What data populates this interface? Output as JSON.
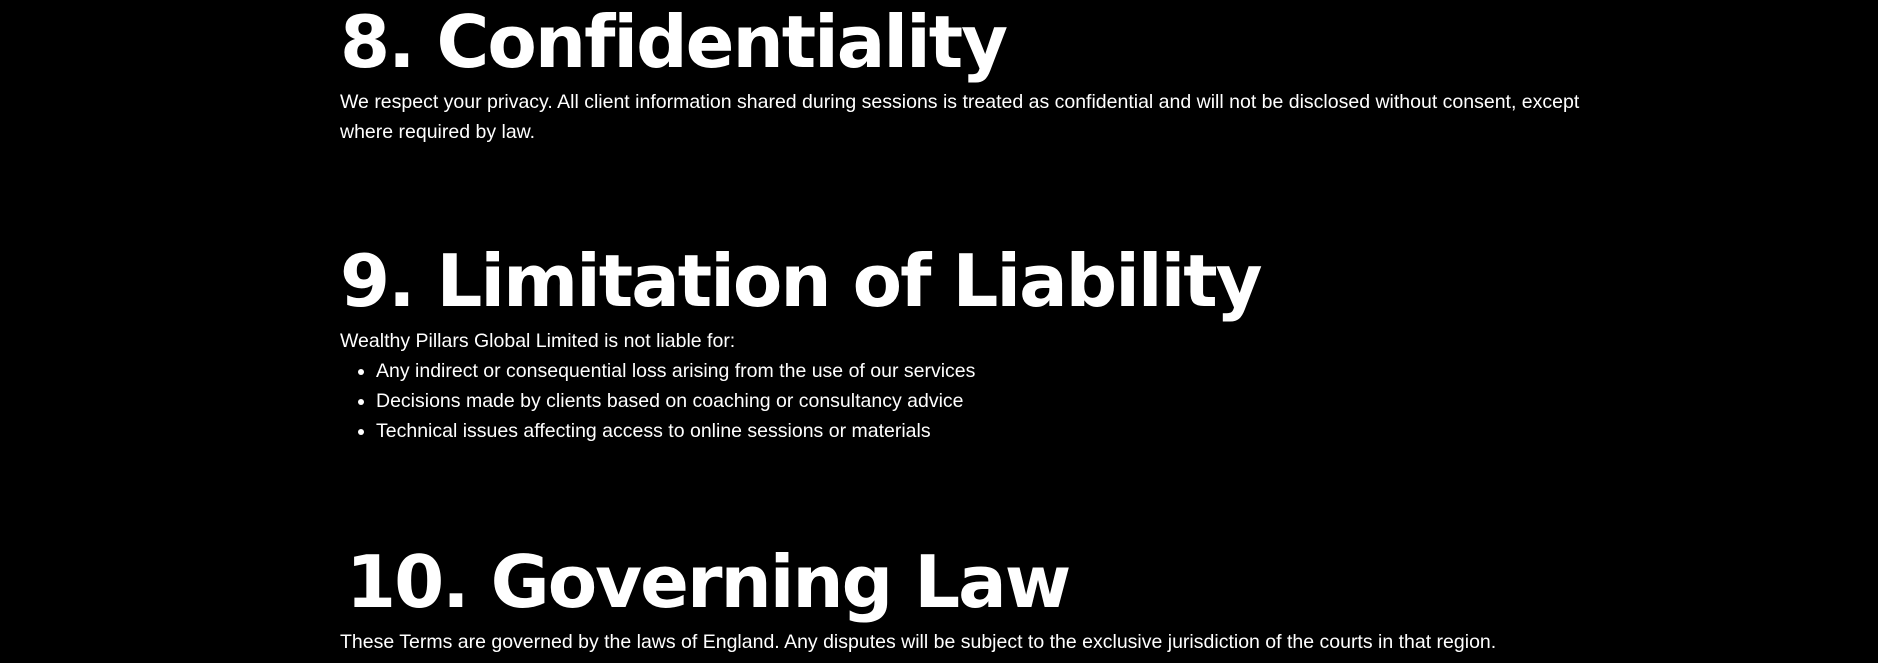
{
  "sections": [
    {
      "heading": "8. Confidentiality",
      "paragraph": "We respect your privacy. All client information shared during sessions is treated as confidential and will not be disclosed without consent, except where required by law."
    },
    {
      "heading": "9. Limitation of Liability",
      "intro": "Wealthy Pillars Global Limited is not liable for:",
      "bullets": [
        "Any indirect or consequential loss arising from the use of our services",
        "Decisions made by clients based on coaching or consultancy advice",
        "Technical issues affecting access to online sessions or materials"
      ]
    },
    {
      "heading": "10. Governing Law",
      "paragraph": "These Terms are governed by the laws of England. Any disputes will be subject to the exclusive jurisdiction of the courts in that region."
    }
  ],
  "colors": {
    "background": "#000000",
    "text": "#ffffff"
  }
}
